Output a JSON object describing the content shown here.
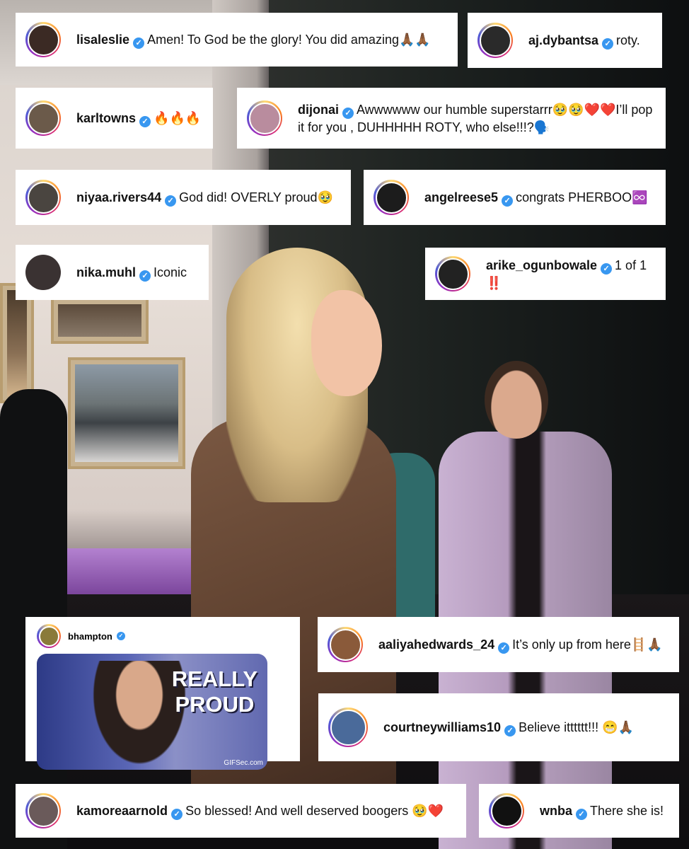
{
  "comments": [
    {
      "user": "lisaleslie",
      "text": "Amen! To God be the glory! You did amazing🙏🏾🙏🏾",
      "avatar_color": "#3b2a24"
    },
    {
      "user": "aj.dybantsa",
      "text": "roty.",
      "avatar_color": "#2a2a2a"
    },
    {
      "user": "karltowns",
      "text": "🔥🔥🔥",
      "avatar_color": "#6b5a4a"
    },
    {
      "user": "dijonai",
      "text": "Awwwwww our humble superstarrr🥹🥹❤️❤️I’ll pop it for you , DUHHHHH ROTY, who else!!!?🗣️",
      "avatar_color": "#b98c9e"
    },
    {
      "user": "niyaa.rivers44",
      "text": "God did! OVERLY proud🥹",
      "avatar_color": "#4a4540"
    },
    {
      "user": "angelreese5",
      "text": "congrats PHERBOO♾️",
      "avatar_color": "#1c1c1c"
    },
    {
      "user": "nika.muhl",
      "text": "Iconic",
      "avatar_color": "#3a3232"
    },
    {
      "user": "arike_ogunbowale",
      "text": "1 of 1 ‼️",
      "avatar_color": "#222"
    },
    {
      "user": "aaliyahedwards_24",
      "text": "It’s only up from here🪜🙏🏾",
      "avatar_color": "#8a5a3a"
    },
    {
      "user": "courtneywilliams10",
      "text": "Believe itttttt!!! 😁🙏🏾",
      "avatar_color": "#4a6a9a"
    },
    {
      "user": "kamoreaarnold",
      "text": "So blessed! And well deserved boogers 🥹❤️",
      "avatar_color": "#6a5a5a"
    },
    {
      "user": "wnba",
      "text": "There she is!",
      "avatar_color": "#111"
    }
  ],
  "gif_comment": {
    "user": "bhampton",
    "gif_line1": "REALLY",
    "gif_line2": "PROUD",
    "gif_credit": "GIFSec.com",
    "avatar_color": "#8a7a3a"
  },
  "verified_mark": "✓",
  "colors": {
    "verified": "#3897f0",
    "card": "#ffffff"
  }
}
